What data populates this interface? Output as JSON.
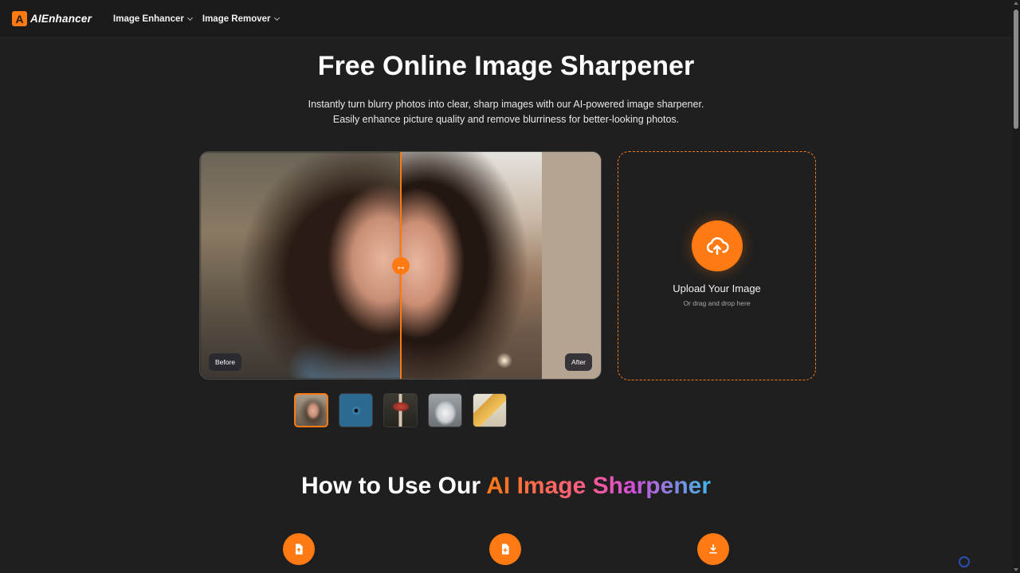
{
  "nav": {
    "logo_mark": "A",
    "logo_text": "AIEnhancer",
    "items": [
      {
        "label": "Image Enhancer"
      },
      {
        "label": "Image Remover"
      }
    ]
  },
  "hero": {
    "title": "Free Online Image Sharpener",
    "subtitle_line1": "Instantly turn blurry photos into clear, sharp images with our AI-powered image sharpener.",
    "subtitle_line2": "Easily enhance picture quality and remove blurriness for better-looking photos."
  },
  "compare": {
    "before_label": "Before",
    "after_label": "After",
    "handle_glyph": "↔"
  },
  "samples": [
    {
      "name": "woman-portrait",
      "selected": true
    },
    {
      "name": "eye",
      "selected": false
    },
    {
      "name": "mushroom",
      "selected": false
    },
    {
      "name": "cat",
      "selected": false
    },
    {
      "name": "golden-box",
      "selected": false
    }
  ],
  "upload": {
    "title": "Upload Your Image",
    "subtitle": "Or drag and drop here",
    "icon": "cloud-upload-icon"
  },
  "howto": {
    "title_plain": "How to Use Our ",
    "title_highlight": "AI Image Sharpener",
    "steps": [
      {
        "icon": "file-upload-icon"
      },
      {
        "icon": "file-process-icon"
      },
      {
        "icon": "download-icon"
      }
    ]
  },
  "colors": {
    "accent": "#ff7a12",
    "background": "#1f1f1f"
  }
}
